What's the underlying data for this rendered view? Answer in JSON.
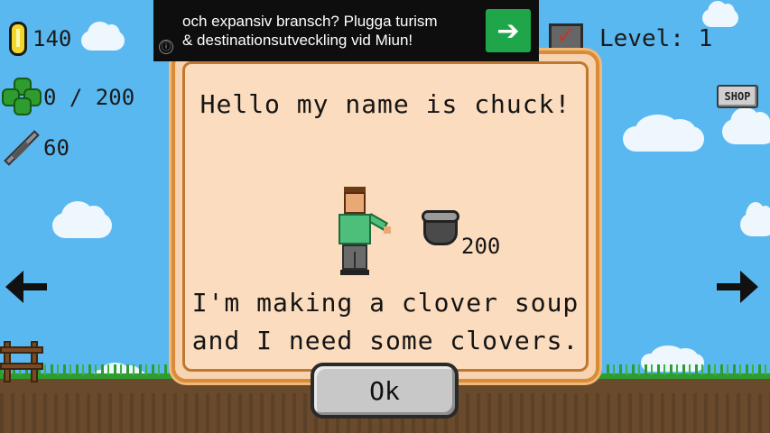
{
  "ad": {
    "line1": "och expansiv bransch? Plugga turism",
    "line2": "& destinationsutveckling vid Miun!",
    "info_icon": "ⓘ",
    "go_icon": "➔",
    "go_color": "#1fa64a"
  },
  "hud": {
    "coins": "140",
    "clovers": "0 / 200",
    "attack": "60",
    "level_label": "Level: 1"
  },
  "shop_label": "SHOP",
  "dialog": {
    "title": "Hello my name is chuck!",
    "pot_count": "200",
    "message_line1": "I'm making a clover soup",
    "message_line2": "and I need some clovers.",
    "ok_label": "Ok"
  },
  "colors": {
    "sky": "#5ab8f0",
    "dialog_bg": "#fbdcbe",
    "dialog_border": "#d98b3a",
    "grass": "#2e9c2e",
    "dirt": "#6a4a2c"
  }
}
